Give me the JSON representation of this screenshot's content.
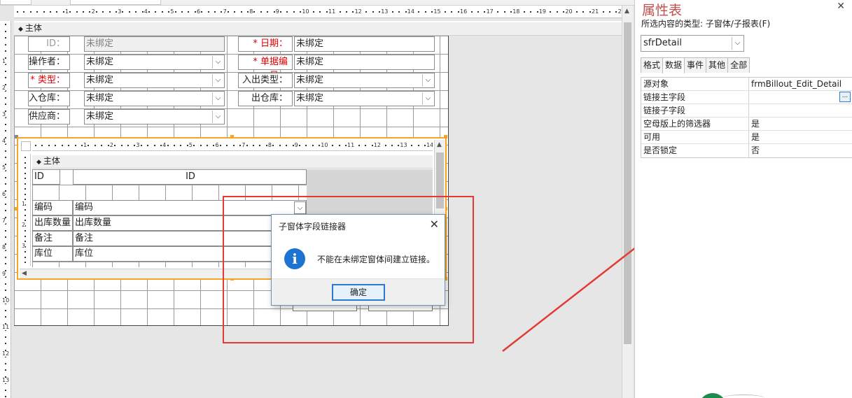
{
  "form": {
    "section_label": "主体",
    "labels": {
      "id": "ID：",
      "operator": "操作者：",
      "type": "* 类型：",
      "in_warehouse": "入仓库：",
      "supplier": "供应商：",
      "date": "* 日期：",
      "bill_no": "* 单据编号：",
      "io_type": "入出类型：",
      "out_warehouse": "出仓库："
    },
    "unbound_text": "未绑定"
  },
  "subform": {
    "section_label": "主体",
    "header_left": "ID",
    "header_center": "ID",
    "rows": [
      {
        "label": "编码",
        "value": "编码"
      },
      {
        "label": "出库数量",
        "value": "出库数量"
      },
      {
        "label": "备注",
        "value": "备注"
      },
      {
        "label": "库位",
        "value": "库位"
      }
    ]
  },
  "ruler": {
    "top": [
      "1",
      "2",
      "3",
      "4",
      "5",
      "6",
      "7",
      "8",
      "9",
      "10",
      "11",
      "12",
      "13",
      "14",
      "15",
      "16",
      "17",
      "18",
      "19",
      "20",
      "21",
      "22"
    ],
    "left": [
      "1",
      "2",
      "3",
      "4",
      "5",
      "6",
      "7",
      "8",
      "9",
      "10",
      "11",
      "12",
      "13"
    ],
    "sub_top": [
      "1",
      "2",
      "3",
      "4",
      "5",
      "6",
      "7",
      "8",
      "9",
      "10",
      "11",
      "12",
      "13",
      "14",
      "15"
    ],
    "sub_left": [
      "1",
      "2",
      "3"
    ]
  },
  "dialog": {
    "title": "子窗体字段链接器",
    "icon": "info-icon",
    "message": "不能在未绑定窗体间建立链接。",
    "ok_label": "确定"
  },
  "property_sheet": {
    "title": "属性表",
    "selection_type_label": "所选内容的类型: 子窗体/子报表(F)",
    "selected_object": "sfrDetail",
    "tabs": [
      "格式",
      "数据",
      "事件",
      "其他",
      "全部"
    ],
    "active_tab": "数据",
    "rows": [
      {
        "key": "源对象",
        "value": "frmBillout_Edit_Detail"
      },
      {
        "key": "链接主字段",
        "value": ""
      },
      {
        "key": "链接子字段",
        "value": ""
      },
      {
        "key": "空母版上的筛选器",
        "value": "是"
      },
      {
        "key": "可用",
        "value": "是"
      },
      {
        "key": "是否锁定",
        "value": "否"
      }
    ],
    "builder_button": "..."
  },
  "colors": {
    "annotation_red": "#e53935",
    "selection_orange": "#f5a623",
    "title_red": "#c0504d",
    "info_blue": "#1e73d2"
  }
}
